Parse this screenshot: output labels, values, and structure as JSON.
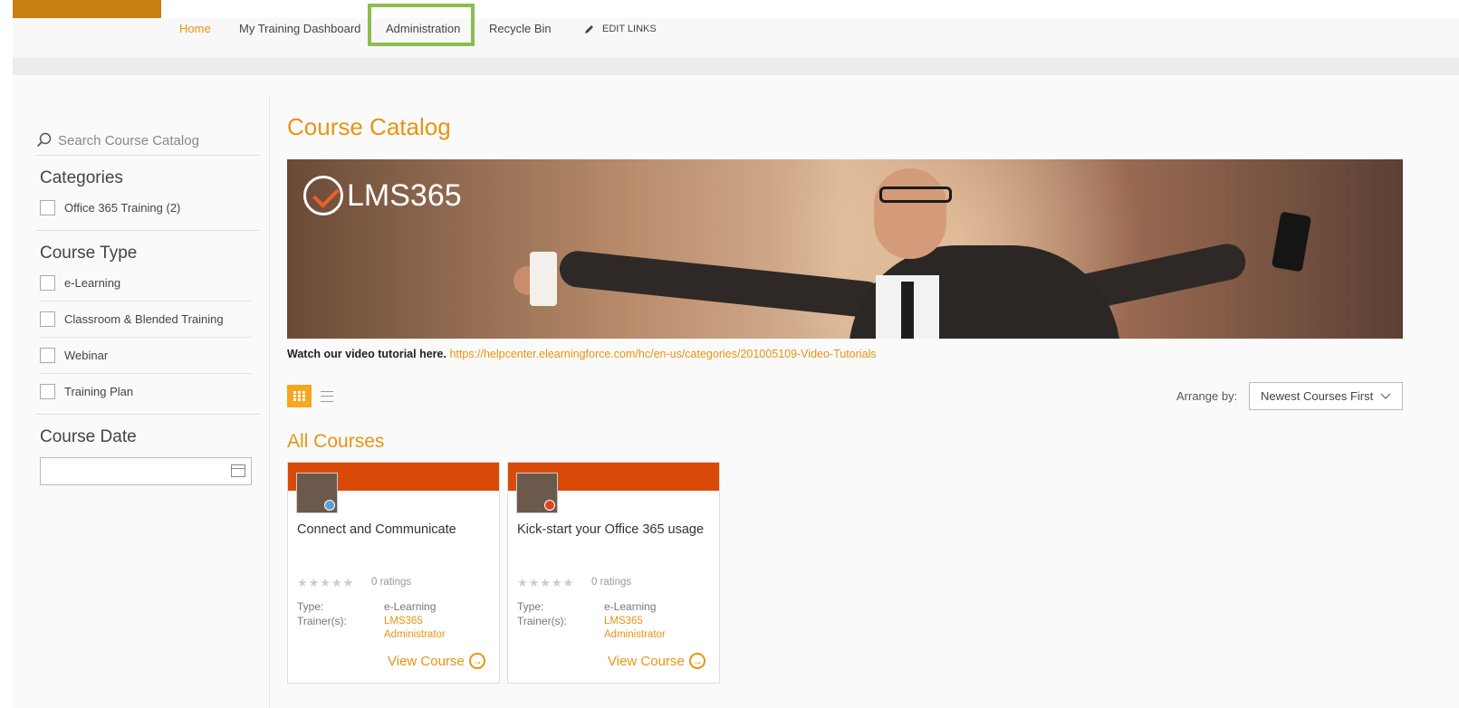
{
  "nav": {
    "items": [
      "Home",
      "My Training Dashboard",
      "Administration",
      "Recycle Bin"
    ],
    "edit_links": "EDIT LINKS"
  },
  "sidebar": {
    "search_placeholder": "Search Course Catalog",
    "categories_title": "Categories",
    "categories": [
      "Office 365 Training (2)"
    ],
    "course_type_title": "Course Type",
    "course_types": [
      "e-Learning",
      "Classroom & Blended Training",
      "Webinar",
      "Training Plan"
    ],
    "course_date_title": "Course Date"
  },
  "main": {
    "title": "Course Catalog",
    "banner_brand": "LMS365",
    "tutorial_lead": "Watch our video tutorial here.",
    "tutorial_link": "https://helpcenter.elearningforce.com/hc/en-us/categories/201005109-Video-Tutorials",
    "arrange_label": "Arrange by:",
    "arrange_value": "Newest Courses First",
    "section_title": "All Courses"
  },
  "courses": [
    {
      "title": "Connect and Communicate",
      "stars": "★★★★★",
      "ratings": "0 ratings",
      "type_label": "Type:",
      "type_value": "e-Learning",
      "trainer_label": "Trainer(s):",
      "trainer_value": "LMS365 Administrator",
      "view_label": "View Course"
    },
    {
      "title": "Kick-start your Office 365 usage",
      "stars": "★★★★★",
      "ratings": "0 ratings",
      "type_label": "Type:",
      "type_value": "e-Learning",
      "trainer_label": "Trainer(s):",
      "trainer_value": "LMS365 Administrator",
      "view_label": "View Course"
    }
  ],
  "colors": {
    "accent": "#e89412",
    "card_header": "#d94a08",
    "highlight": "#8cbd4f"
  },
  "icons": [
    "search-icon",
    "pencil-icon",
    "grid-view-icon",
    "list-view-icon",
    "calendar-icon",
    "chevron-down-icon",
    "arrow-right-circle-icon"
  ]
}
